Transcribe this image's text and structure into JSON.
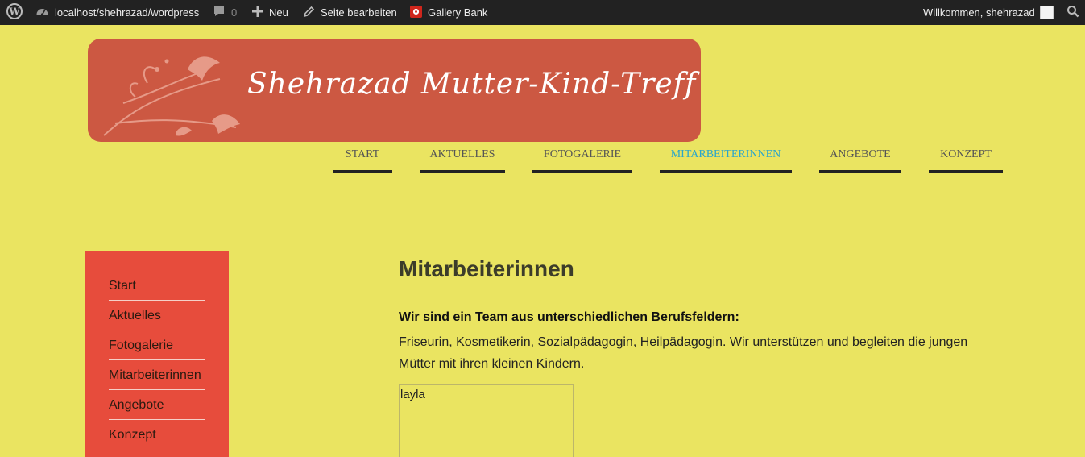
{
  "adminbar": {
    "site_url": "localhost/shehrazad/wordpress",
    "comments_count": "0",
    "new_label": "Neu",
    "edit_label": "Seite bearbeiten",
    "gallery_label": "Gallery Bank",
    "welcome_label": "Willkommen, shehrazad",
    "icons": {
      "wordpress": "wordpress-logo-icon",
      "site": "dashboard-icon",
      "comments": "comment-bubble-icon",
      "new": "plus-icon",
      "edit": "pencil-icon",
      "gallery": "gear-badge-icon",
      "search": "search-icon"
    },
    "gallery_icon_color": "#d54e21"
  },
  "header": {
    "site_title": "Shehrazad Mutter-Kind-Treff",
    "banner_color": "#cc5842"
  },
  "topnav": {
    "items": [
      {
        "label": "START"
      },
      {
        "label": "AKTUELLES"
      },
      {
        "label": "FOTOGALERIE"
      },
      {
        "label": "MITARBEITERINNEN",
        "active": true
      },
      {
        "label": "ANGEBOTE"
      },
      {
        "label": "KONZEPT"
      }
    ],
    "active_color": "#2ba6cb"
  },
  "sidebar": {
    "items": [
      {
        "label": "Start"
      },
      {
        "label": "Aktuelles"
      },
      {
        "label": "Fotogalerie"
      },
      {
        "label": "Mitarbeiterinnen"
      },
      {
        "label": "Angebote"
      },
      {
        "label": "Konzept"
      }
    ],
    "bg_color": "#e74c3c"
  },
  "content": {
    "title": "Mitarbeiterinnen",
    "intro_bold": "Wir sind ein Team aus unterschiedlichen Berufsfeldern:",
    "intro_text": "Friseurin, Kosmetikerin, Sozialpädagogin, Heilpädagogin. Wir unterstützen und begleiten die jungen Mütter mit ihren kleinen Kindern.",
    "gallery_caption": "layla"
  },
  "page_bg_color": "#eae461"
}
